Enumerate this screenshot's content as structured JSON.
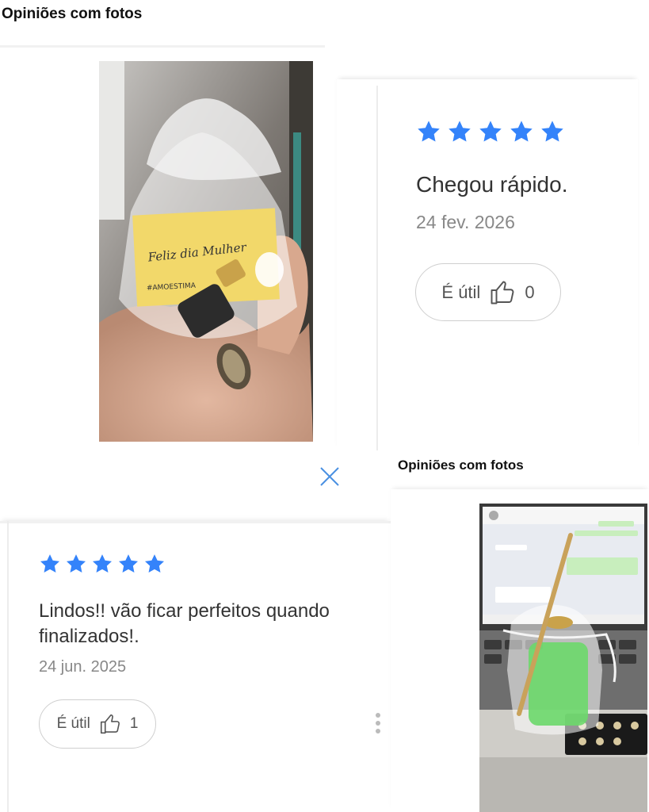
{
  "section_title": "Opiniões com fotos",
  "section_title_2": "Opiniões com fotos",
  "colors": {
    "star": "#3483fa",
    "date": "#888888",
    "text": "#333333"
  },
  "review_1": {
    "rating": 5,
    "text": "Chegou rápido.",
    "date": "24 fev. 2026",
    "useful_label": "É útil",
    "useful_count": "0"
  },
  "review_2": {
    "rating": 5,
    "text": "Lindos!! vão ficar perfeitos quando finalizados!.",
    "date": "24 jun. 2025",
    "useful_label": "É útil",
    "useful_count": "1"
  },
  "photo_1": {
    "note_line_1": "Feliz dia Mulher",
    "note_line_2": "#AMOESTIMA"
  },
  "icons": {
    "close": "close-icon",
    "like": "thumbs-up-icon",
    "more": "more-options-icon",
    "star": "star-icon"
  }
}
